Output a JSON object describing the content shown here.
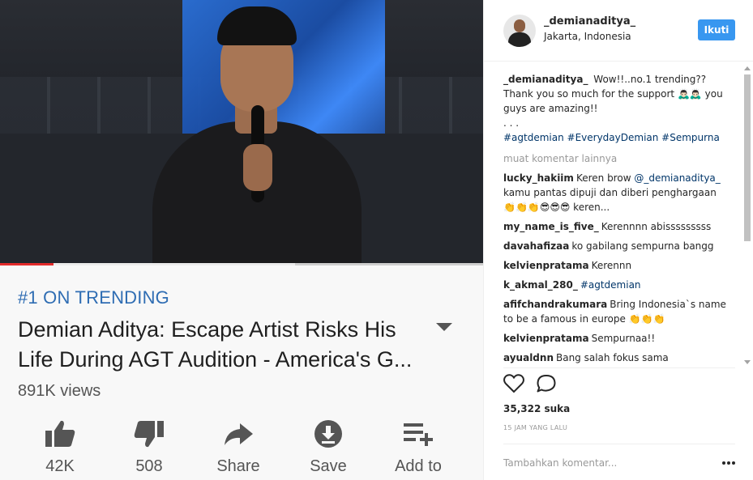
{
  "post": {
    "username": "_demianaditya_",
    "location": "Jakarta, Indonesia",
    "follow_label": "Ikuti",
    "caption": {
      "username": "_demianaditya_",
      "text": "Wow!!..no.1 trending?? Thank you so much for the support 🙇🏻‍♂️🙇🏻‍♂️ you guys are amazing!!",
      "ellipsis": ". . .",
      "hashtags": "#agtdemian #EverydayDemian #Sempurna"
    },
    "load_more": "muat komentar lainnya",
    "comments": [
      {
        "user": "lucky_hakiim",
        "text_before": "Keren brow ",
        "mention": "@_demianaditya_",
        "text_after": " kamu pantas dipuji dan diberi penghargaan 👏👏👏😎😎😎 keren..."
      },
      {
        "user": "my_name_is_five_",
        "text_before": "Kerennnn abisssssssss",
        "mention": "",
        "text_after": ""
      },
      {
        "user": "davahafizaa",
        "text_before": "ko gabilang sempurna bangg",
        "mention": "",
        "text_after": ""
      },
      {
        "user": "kelvienpratama",
        "text_before": "Kerennn",
        "mention": "",
        "text_after": ""
      },
      {
        "user": "k_akmal_280_",
        "text_before": "",
        "mention": "#agtdemian",
        "text_after": ""
      },
      {
        "user": "afifchandrakumara",
        "text_before": "Bring Indonesia`s name to be a famous in europe 👏👏👏",
        "mention": "",
        "text_after": ""
      },
      {
        "user": "kelvienpratama",
        "text_before": "Sempurnaa!!",
        "mention": "",
        "text_after": ""
      },
      {
        "user": "ayualdnn",
        "text_before": "Bang salah fokus sama",
        "mention": "",
        "text_after": ""
      }
    ],
    "likes": "35,322 suka",
    "timestamp": "15 JAM YANG LALU",
    "add_comment_placeholder": "Tambahkan komentar...",
    "icons": {
      "like": "heart-icon",
      "comment": "comment-icon",
      "more": "more-options-icon"
    }
  },
  "video_screenshot": {
    "trending_label": "#1 ON TRENDING",
    "title": "Demian Aditya: Escape Artist Risks His Life During AGT Audition - America's G...",
    "views": "891K views",
    "progress": 0.11,
    "buffered": 0.61,
    "actions": [
      {
        "icon": "thumbs-up-icon",
        "label": "42K"
      },
      {
        "icon": "thumbs-down-icon",
        "label": "508"
      },
      {
        "icon": "share-icon",
        "label": "Share"
      },
      {
        "icon": "download-icon",
        "label": "Save"
      },
      {
        "icon": "add-to-playlist-icon",
        "label": "Add to"
      }
    ]
  },
  "colors": {
    "follow_button": "#3897f0",
    "hashtag": "#003569",
    "trending": "#2f6db3",
    "progress": "#e32b2b"
  }
}
